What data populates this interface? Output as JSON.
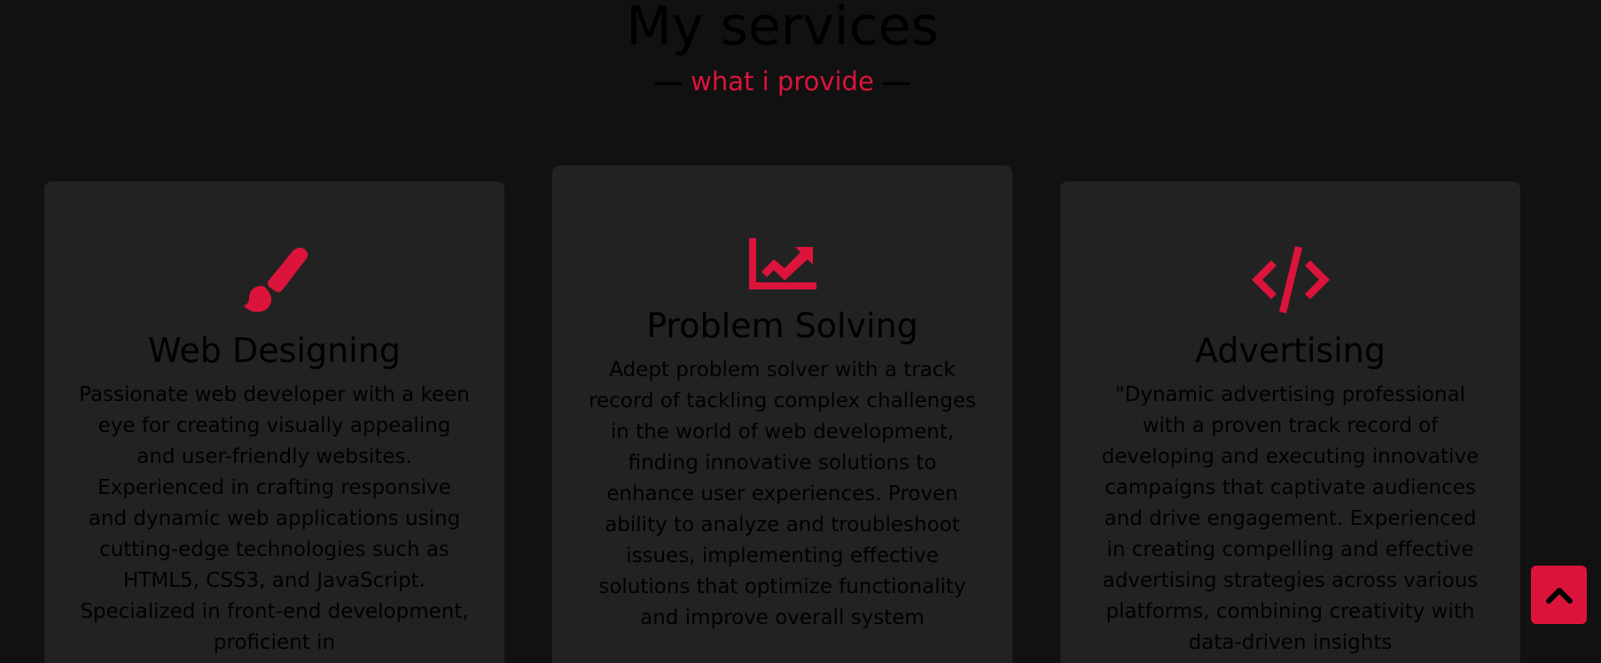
{
  "section": {
    "title": "My services",
    "subtitle": "what i provide"
  },
  "colors": {
    "background": "#111111",
    "card": "#222222",
    "accent": "#dc143c",
    "text": "#000000"
  },
  "cards": [
    {
      "icon": "paint-brush-icon",
      "title": "Web Designing",
      "text": "Passionate web developer with a keen eye for creating visually appealing and user-friendly websites. Experienced in crafting responsive and dynamic web applications using cutting-edge technologies such as HTML5, CSS3, and JavaScript. Specialized in front-end development, proficient in"
    },
    {
      "icon": "chart-line-icon",
      "title": "Problem Solving",
      "text": "Adept problem solver with a track record of tackling complex challenges in the world of web development, finding innovative solutions to enhance user experiences. Proven ability to analyze and troubleshoot issues, implementing effective solutions that optimize functionality and improve overall system"
    },
    {
      "icon": "code-icon",
      "title": "Advertising",
      "text": "\"Dynamic advertising professional with a proven track record of developing and executing innovative campaigns that captivate audiences and drive engagement. Experienced in creating compelling and effective advertising strategies across various platforms, combining creativity with data-driven insights"
    }
  ],
  "scroll_top": {
    "icon": "chevron-up-icon"
  }
}
